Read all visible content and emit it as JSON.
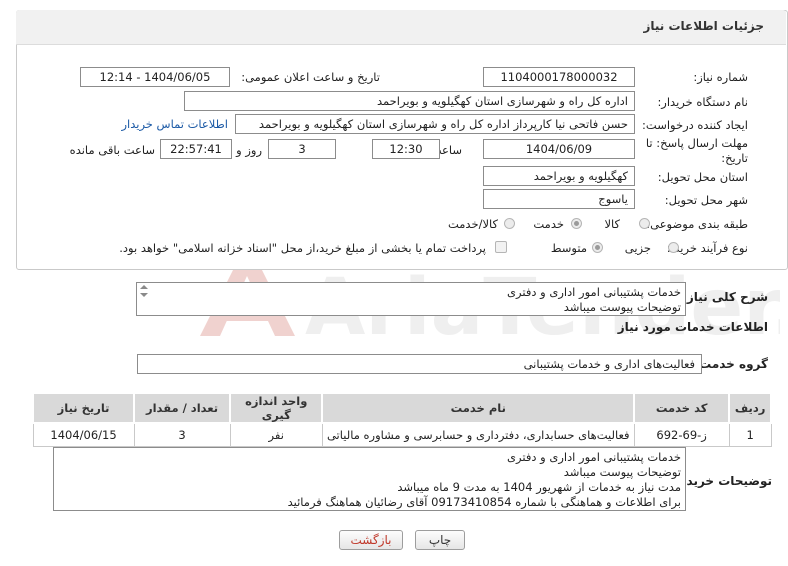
{
  "panel": {
    "title": "جزئیات اطلاعات نیاز"
  },
  "form": {
    "need_number": {
      "label": "شماره نیاز:",
      "value": "1104000178000032"
    },
    "announce_date": {
      "label": "تاریخ و ساعت اعلان عمومی:",
      "value": "1404/06/05 - 12:14"
    },
    "buyer_org": {
      "label": "نام دستگاه خریدار:",
      "value": "اداره کل راه و شهرسازی استان کهگیلویه و بویراحمد"
    },
    "requester": {
      "label": "ایجاد کننده درخواست:",
      "value": "حسن فاتحی نیا کارپرداز اداره کل راه و شهرسازی استان کهگیلویه و بویراحمد",
      "contact_link": "اطلاعات تماس خریدار"
    },
    "deadline": {
      "label_line1": "مهلت ارسال پاسخ: تا",
      "label_line2": "تاریخ:",
      "date": "1404/06/09",
      "time_label": "ساعت",
      "time": "12:30",
      "days": "3",
      "days_label": "روز و",
      "remaining": "22:57:41",
      "remaining_label": "ساعت باقی مانده"
    },
    "province": {
      "label": "استان محل تحویل:",
      "value": "کهگیلویه و بویراحمد"
    },
    "city": {
      "label": "شهر محل تحویل:",
      "value": "یاسوج"
    },
    "category": {
      "label": "طبقه بندی موضوعی:",
      "options": [
        "کالا",
        "خدمت",
        "کالا/خدمت"
      ],
      "selected": "خدمت"
    },
    "purchase_type": {
      "label": "نوع فرآیند خرید :",
      "options": [
        "جزیی",
        "متوسط"
      ],
      "selected": "متوسط",
      "payment_note": "پرداخت تمام یا بخشی از مبلغ خرید،از محل \"اسناد خزانه اسلامی\" خواهد بود."
    }
  },
  "summary": {
    "label": "شرح کلی نیاز:",
    "text": "خدمات پشتیبانی امور اداری و دفتری\nتوضیحات پیوست میباشد"
  },
  "services_section": {
    "title": "اطلاعات خدمات مورد نیاز",
    "group_label": "گروه خدمت:",
    "group_value": "فعالیت‌های اداری و خدمات پشتیبانی",
    "table": {
      "headers": [
        "ردیف",
        "کد خدمت",
        "نام خدمت",
        "واحد اندازه گیری",
        "تعداد / مقدار",
        "تاریخ نیاز"
      ],
      "rows": [
        [
          "1",
          "ز-69-692",
          "فعالیت‌های حسابداری، دفترداری و حسابرسی و مشاوره مالیاتی",
          "نفر",
          "3",
          "1404/06/15"
        ]
      ]
    }
  },
  "buyer_notes": {
    "label": "توضیحات خریدار:",
    "text": "خدمات پشتیبانی امور اداری و دفتری\nتوضیحات پیوست میباشد\nمدت نیاز به خدمات از شهریور 1404 به مدت 9 ماه میباشد\nبرای اطلاعات و هماهنگی با شماره 09173410854 آقای رضائیان هماهنگ فرمائید"
  },
  "buttons": {
    "print": "چاپ",
    "back": "بازگشت"
  },
  "watermark": {
    "text": "AriaTender.net"
  }
}
